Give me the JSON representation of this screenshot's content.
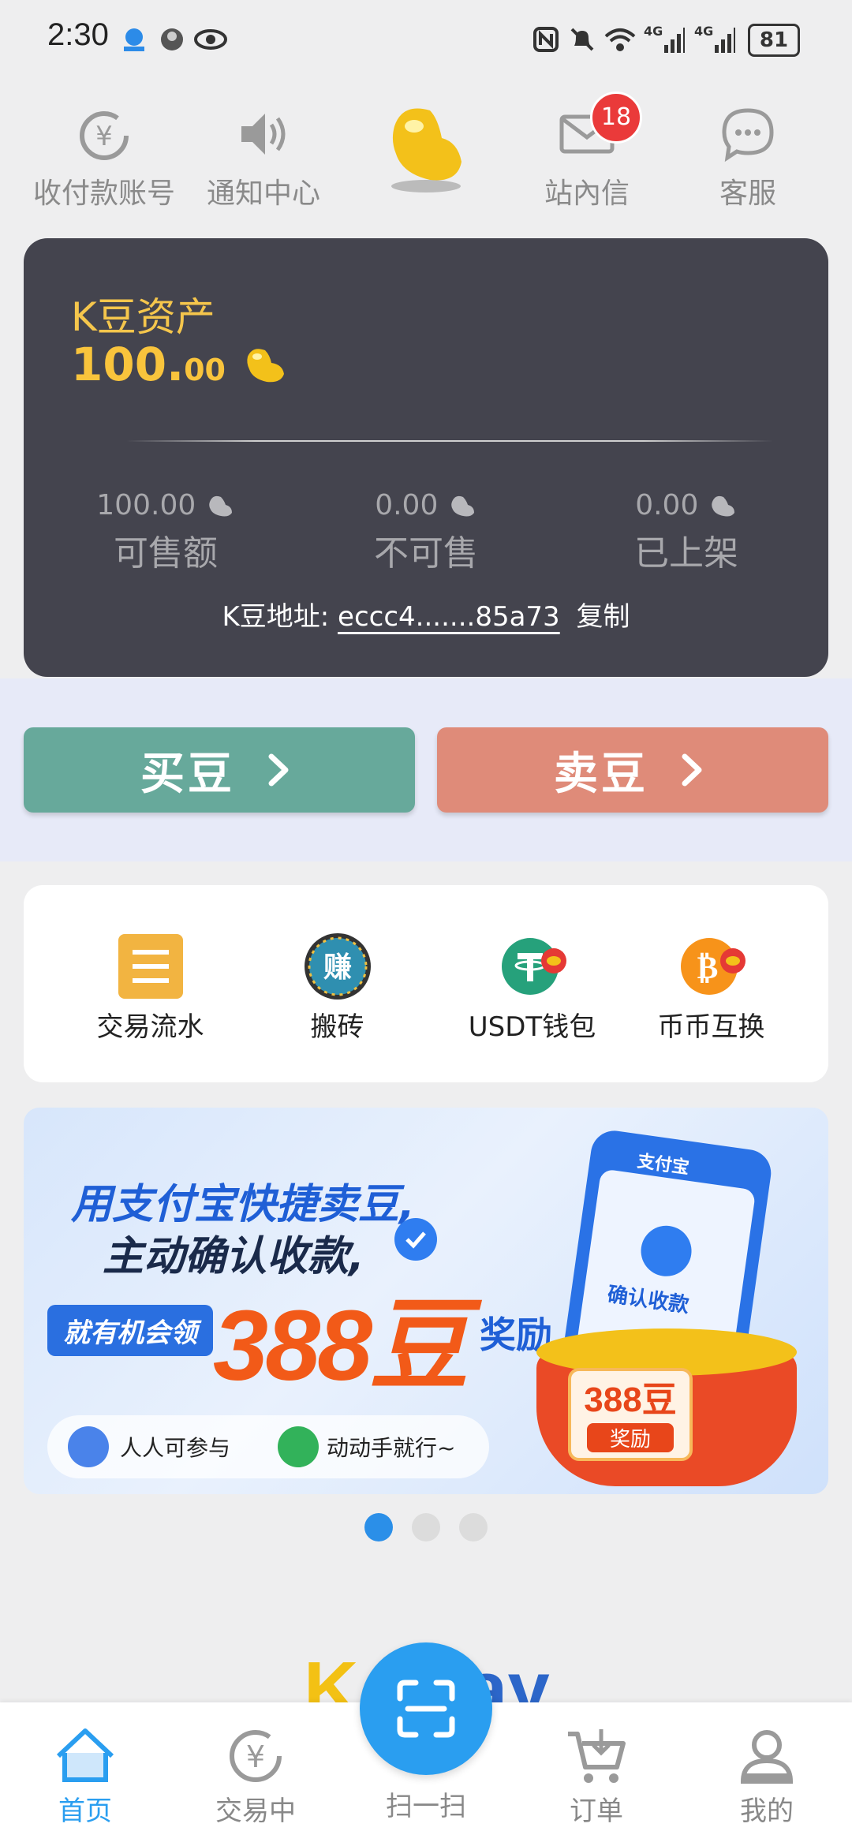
{
  "status_bar": {
    "time": "2:30",
    "battery": "81",
    "signal_labels": [
      "4G",
      "4G"
    ]
  },
  "top_nav": {
    "items": [
      {
        "label": "收付款账号",
        "icon": "yen-coin-icon"
      },
      {
        "label": "通知中心",
        "icon": "speaker-icon"
      },
      {
        "label": "",
        "icon": "golden-bean-icon"
      },
      {
        "label": "站內信",
        "icon": "mail-icon",
        "badge": "18"
      },
      {
        "label": "客服",
        "icon": "chat-bubble-icon"
      }
    ]
  },
  "asset_card": {
    "title": "K豆资产",
    "amount_main": "100.",
    "amount_decimal": "00",
    "stats": [
      {
        "value": "100.00",
        "label": "可售额"
      },
      {
        "value": "0.00",
        "label": "不可售"
      },
      {
        "value": "0.00",
        "label": "已上架"
      }
    ],
    "address_label": "K豆地址:",
    "address_value": "eccc4.......85a73",
    "copy_label": "复制"
  },
  "actions": {
    "buy_label": "买豆",
    "sell_label": "卖豆",
    "buy_color": "#67a99b",
    "sell_color": "#df8b79"
  },
  "menu": {
    "items": [
      {
        "label": "交易流水",
        "icon": "ledger-icon"
      },
      {
        "label": "搬砖",
        "icon": "earn-badge-icon",
        "icon_text": "赚"
      },
      {
        "label": "USDT钱包",
        "icon": "tether-wallet-icon"
      },
      {
        "label": "币币互换",
        "icon": "bitcoin-swap-icon"
      }
    ]
  },
  "banner": {
    "line1": "用支付宝快捷卖豆,",
    "line2": "主动确认收款,",
    "tag": "就有机会领",
    "reward_number": "388豆",
    "reward_suffix": "奖励",
    "pill1": "人人可参与",
    "pill2": "动动手就行~",
    "phone_brand": "支付宝",
    "phone_text": "确认收款",
    "bowl_number": "388豆",
    "bowl_label": "奖励"
  },
  "carousel": {
    "count": 3,
    "active": 0
  },
  "logo": {
    "left": "K",
    "right": "ay"
  },
  "bottom_nav": {
    "items": [
      {
        "label": "首页",
        "icon": "home-icon",
        "active": true
      },
      {
        "label": "交易中",
        "icon": "yen-cycle-icon"
      },
      {
        "label": "扫一扫",
        "icon": "scan-icon"
      },
      {
        "label": "订单",
        "icon": "cart-icon"
      },
      {
        "label": "我的",
        "icon": "profile-icon"
      }
    ]
  },
  "colors": {
    "card_bg": "#44444e",
    "gold": "#f9c43c",
    "accent_blue": "#2a9ef0",
    "badge_red": "#ea3a3a"
  }
}
